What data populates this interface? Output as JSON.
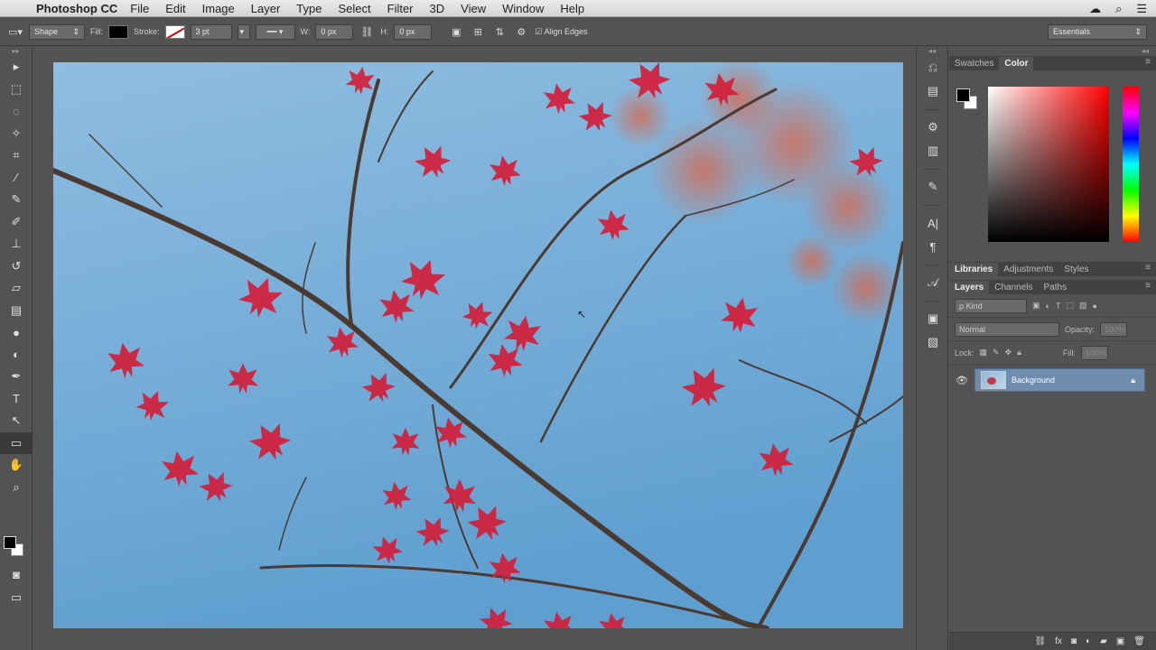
{
  "app": {
    "name": "Photoshop CC"
  },
  "menubar": {
    "apple": "",
    "items": [
      "File",
      "Edit",
      "Image",
      "Layer",
      "Type",
      "Select",
      "Filter",
      "3D",
      "View",
      "Window",
      "Help"
    ]
  },
  "options_bar": {
    "tool_mode": "Shape",
    "fill_label": "Fill:",
    "stroke_label": "Stroke:",
    "stroke_width": "3 pt",
    "w_label": "W:",
    "w_value": "0 px",
    "link_icon": "link-icon",
    "h_label": "H:",
    "h_value": "0 px",
    "align_edges_label": "Align Edges",
    "align_edges_checked": true,
    "workspace": "Essentials"
  },
  "tools": [
    {
      "name": "move-tool",
      "glyph": "▸"
    },
    {
      "name": "marquee-tool",
      "glyph": "⬚"
    },
    {
      "name": "lasso-tool",
      "glyph": "◌"
    },
    {
      "name": "quick-select-tool",
      "glyph": "✧"
    },
    {
      "name": "crop-tool",
      "glyph": "⌗"
    },
    {
      "name": "eyedropper-tool",
      "glyph": "⁄"
    },
    {
      "name": "healing-brush-tool",
      "glyph": "✎"
    },
    {
      "name": "brush-tool",
      "glyph": "✐"
    },
    {
      "name": "clone-stamp-tool",
      "glyph": "⊥"
    },
    {
      "name": "history-brush-tool",
      "glyph": "↺"
    },
    {
      "name": "eraser-tool",
      "glyph": "▱"
    },
    {
      "name": "gradient-tool",
      "glyph": "▤"
    },
    {
      "name": "blur-tool",
      "glyph": "●"
    },
    {
      "name": "dodge-tool",
      "glyph": "◐"
    },
    {
      "name": "pen-tool",
      "glyph": "✒"
    },
    {
      "name": "type-tool",
      "glyph": "T"
    },
    {
      "name": "path-select-tool",
      "glyph": "↖"
    },
    {
      "name": "rectangle-tool",
      "glyph": "▭",
      "active": true
    },
    {
      "name": "hand-tool",
      "glyph": "✋"
    },
    {
      "name": "zoom-tool",
      "glyph": "⌕"
    }
  ],
  "color_panel": {
    "tabs": [
      "Swatches",
      "Color"
    ],
    "active_tab": "Color"
  },
  "libraries_panel": {
    "tabs": [
      "Libraries",
      "Adjustments",
      "Styles"
    ],
    "active_tab": "Libraries"
  },
  "layers_panel": {
    "tabs": [
      "Layers",
      "Channels",
      "Paths"
    ],
    "active_tab": "Layers",
    "filter_kind": "ρ Kind",
    "blend_mode": "Normal",
    "opacity_label": "Opacity:",
    "opacity_value": "100%",
    "lock_label": "Lock:",
    "fill_label": "Fill:",
    "fill_value": "100%",
    "layers": [
      {
        "name": "Background",
        "visible": true,
        "locked": true
      }
    ]
  },
  "canvas": {
    "sky_top": "#8fbde0",
    "sky_bottom": "#5f9fd0",
    "branch_color": "#4a3a32",
    "leaf_color": "#d21e3a"
  }
}
